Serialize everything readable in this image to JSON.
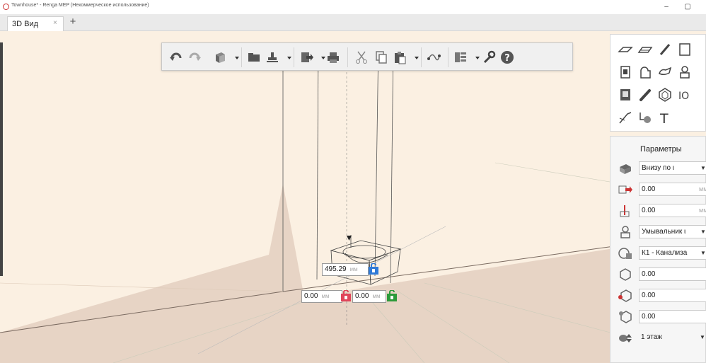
{
  "window": {
    "title": "Townhouse* - Renga MEP (Некоммерческое использование)",
    "minimize_glyph": "–",
    "restore_glyph": "▢"
  },
  "tabs": [
    {
      "label": "3D Вид",
      "close_glyph": "×"
    }
  ],
  "add_tab_glyph": "+",
  "toolbar": {
    "items": [
      "undo-icon",
      "redo-icon",
      "view-cube-icon",
      "folder-icon",
      "stamp-icon",
      "export-icon",
      "print-icon",
      "cut-icon",
      "copy-icon",
      "paste-icon",
      "snap-icon",
      "layers-icon",
      "wrench-icon",
      "help-icon"
    ]
  },
  "palette": {
    "tools": [
      "slab-tool",
      "plate-tool",
      "pen-tool",
      "duct-tool",
      "equipment-tool",
      "fixture-tool",
      "valve-tool",
      "pipe-fitting-tool",
      "cabinet-tool",
      "brush-tool",
      "hexagon-tool",
      "io-tool",
      "line-tool",
      "axis-tool",
      "text-tool"
    ],
    "text_tool_glyph": "T",
    "io_tool_glyph": "IO"
  },
  "parameters": {
    "title": "Параметры",
    "rows": [
      {
        "value": "Внизу по ι",
        "unit": "",
        "has_dropdown": true
      },
      {
        "value": "0.00",
        "unit": "мм",
        "has_dropdown": false
      },
      {
        "value": "0.00",
        "unit": "мм",
        "has_dropdown": false
      },
      {
        "value": "Умывальник ι",
        "unit": "",
        "has_dropdown": true
      },
      {
        "value": "К1 - Канализа",
        "unit": "",
        "has_dropdown": true
      },
      {
        "value": "0.00",
        "unit": "",
        "has_dropdown": false
      },
      {
        "value": "0.00",
        "unit": "",
        "has_dropdown": false
      },
      {
        "value": "0.00",
        "unit": "",
        "has_dropdown": false
      },
      {
        "value": "1 этаж",
        "unit": "",
        "has_dropdown": true
      }
    ]
  },
  "dimensions": {
    "height": {
      "value": "495.29",
      "unit": "мм"
    },
    "x": {
      "value": "0.00",
      "unit": "мм"
    },
    "y": {
      "value": "0.00",
      "unit": "мм"
    }
  },
  "colors": {
    "floor": "#e7d4c5",
    "wall": "#fbf0e2",
    "lock_blue": "#2f7ad8",
    "lock_red": "#e0455a",
    "lock_green": "#2c9a3a"
  }
}
